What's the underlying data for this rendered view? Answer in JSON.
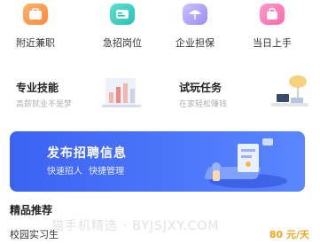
{
  "categories": [
    {
      "label": "附近兼职",
      "icon": "briefcase-icon",
      "color": "#ff8a3c"
    },
    {
      "label": "急招岗位",
      "icon": "id-card-icon",
      "color": "#25c2b4"
    },
    {
      "label": "企业担保",
      "icon": "umbrella-icon",
      "color": "#9a8cf5"
    },
    {
      "label": "当日上手",
      "icon": "bag-icon",
      "color": "#ff6aa8"
    }
  ],
  "features": [
    {
      "title": "专业技能",
      "subtitle": "高薪就业不是梦"
    },
    {
      "title": "试玩任务",
      "subtitle": "在家轻松赚钱"
    }
  ],
  "banner": {
    "title": "发布招聘信息",
    "subtitle": "快速招人  快捷管理",
    "color_start": "#3b62f2",
    "color_end": "#5a86ff"
  },
  "featured": {
    "section_title": "精品推荐",
    "jobs": [
      {
        "name": "校园实习生",
        "pay": "80 元/天"
      }
    ]
  },
  "watermark": "猫手机精选 · BYJSJXY.COM"
}
